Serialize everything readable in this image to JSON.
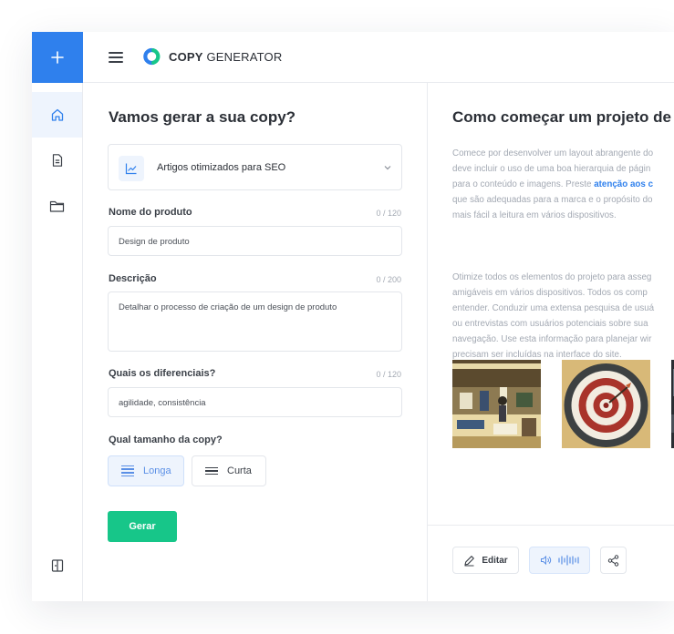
{
  "brand": {
    "bold": "COPY",
    "rest": "GENERATOR"
  },
  "sidebar": {
    "items": [
      {
        "icon": "home-icon",
        "active": true
      },
      {
        "icon": "document-icon",
        "active": false
      },
      {
        "icon": "folder-icon",
        "active": false
      }
    ],
    "bottom_icon": "book-icon"
  },
  "form": {
    "title": "Vamos gerar a sua copy?",
    "template": "Artigos otimizados para SEO",
    "fields": [
      {
        "label": "Nome do produto",
        "counter": "0 / 120",
        "value": "Design de produto"
      },
      {
        "label": "Descrição",
        "counter": "0 / 200",
        "value": "Detalhar o processo de criação de um design de produto"
      },
      {
        "label": "Quais os diferenciais?",
        "counter": "0 / 120",
        "value": "agilidade, consistência"
      }
    ],
    "size_label": "Qual tamanho da copy?",
    "size_options": {
      "long": "Longa",
      "short": "Curta"
    },
    "submit": "Gerar"
  },
  "output": {
    "title": "Como começar um projeto de d",
    "para1": {
      "lines": [
        "Comece por desenvolver um layout abrangente do",
        "deve incluir o uso de uma boa hierarquia de págin",
        "para o conteúdo e imagens. Preste "
      ],
      "highlight": "atenção aos c",
      "after": [
        "que são adequadas para a marca e o propósito do",
        "mais fácil a leitura em vários dispositivos."
      ]
    },
    "para2": [
      "Otimize todos os elementos do projeto para asseg",
      "amigáveis em vários dispositivos. Todos os comp",
      "entender. Conduzir uma extensa pesquisa de usuá",
      "ou entrevistas com usuários potenciais sobre sua",
      "navegação. Use esta informação para planejar wir",
      "precisam ser incluídas na interface do site."
    ],
    "edit": "Editar"
  }
}
